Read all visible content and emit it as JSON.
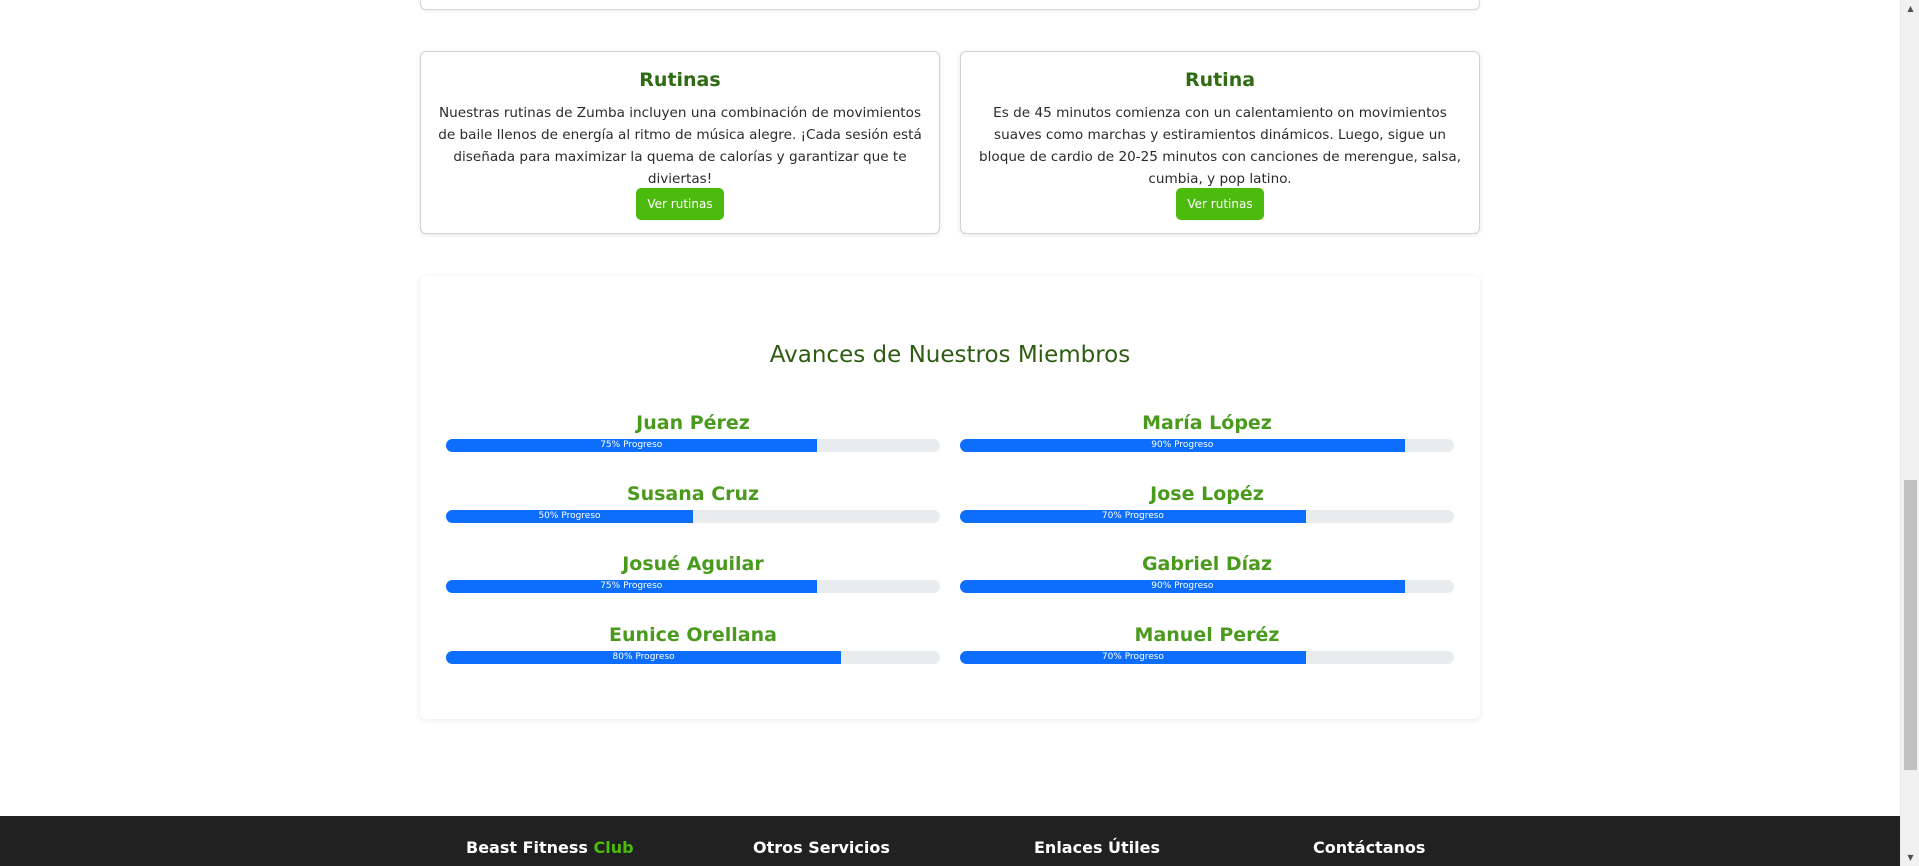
{
  "cards": [
    {
      "title": "Rutinas",
      "text": "Nuestras rutinas de Zumba incluyen una combinación de movimientos de baile llenos de energía al ritmo de música alegre. ¡Cada sesión está diseñada para maximizar la quema de calorías y garantizar que te diviertas!",
      "button": "Ver rutinas"
    },
    {
      "title": "Rutina",
      "text": "Es de 45 minutos comienza con un calentamiento on movimientos suaves como marchas y estiramientos dinámicos. Luego, sigue un bloque de cardio de 20-25 minutos con canciones de merengue, salsa, cumbia, y pop latino.",
      "button": "Ver rutinas"
    }
  ],
  "progress": {
    "title": "Avances de Nuestros Miembros",
    "members": [
      {
        "name": "Juan Pérez",
        "label": "75% Progreso",
        "percent": 75
      },
      {
        "name": "María López",
        "label": "90% Progreso",
        "percent": 90
      },
      {
        "name": "Susana Cruz",
        "label": "50% Progreso",
        "percent": 50
      },
      {
        "name": "Jose Lopéz",
        "label": "70% Progreso",
        "percent": 70
      },
      {
        "name": "Josué Aguilar",
        "label": "75% Progreso",
        "percent": 75
      },
      {
        "name": "Gabriel Díaz",
        "label": "90% Progreso",
        "percent": 90
      },
      {
        "name": "Eunice Orellana",
        "label": "80% Progreso",
        "percent": 80
      },
      {
        "name": "Manuel Peréz",
        "label": "70% Progreso",
        "percent": 70
      }
    ],
    "bar_color": "#0d6efd",
    "track_color": "#e9ecef",
    "name_color": "#4a9a1e"
  },
  "footer": {
    "brand_main": "Beast Fitness",
    "brand_accent": "Club",
    "col2": "Otros Servicios",
    "col3": "Enlaces Útiles",
    "col4": "Contáctanos"
  },
  "colors": {
    "accent_green": "#4cbb0e",
    "title_green": "#2f6b12",
    "footer_bg": "#212121"
  }
}
